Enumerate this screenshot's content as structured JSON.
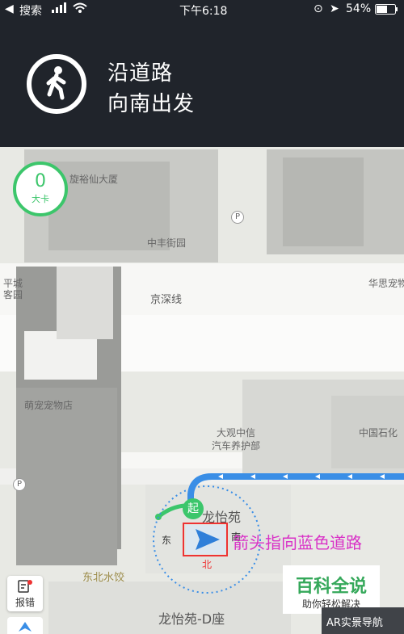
{
  "status_bar": {
    "back_app": "搜索",
    "time": "下午6:18",
    "battery": "54%"
  },
  "navigation": {
    "line1": "沿道路",
    "line2": "向南出发",
    "maneuver_icon": "pedestrian-icon"
  },
  "calorie": {
    "value": "0",
    "unit": "大卡"
  },
  "map": {
    "labels": {
      "store_top": "旋裕仙大厦",
      "parking_p1": "P",
      "shop_mid": "中丰街园",
      "area_left": "平城",
      "area_left2": "客园",
      "right_top": "华思宠物",
      "road": "京深线",
      "pet_shop": "萌宠宠物店",
      "car_care": "大观中信",
      "car_care2": "汽车养护部",
      "right_bottom": "中国石化",
      "parking_p2": "P",
      "community": "龙怡苑",
      "restaurant": "东北水饺",
      "building": "龙怡苑-D座",
      "dir_east": "东",
      "dir_south": "南",
      "dir_north": "北"
    },
    "start_marker": "起"
  },
  "controls": {
    "report": "报错",
    "ar_nav": "AR实景导航"
  },
  "annotation": {
    "text": "箭头指向蓝色道路"
  },
  "watermark": {
    "title": "百科全说",
    "subtitle": "助你轻松解决"
  },
  "colors": {
    "banner": "#20242b",
    "route": "#3a8ee6",
    "green": "#3cc66b",
    "annotation": "#d932c7"
  }
}
